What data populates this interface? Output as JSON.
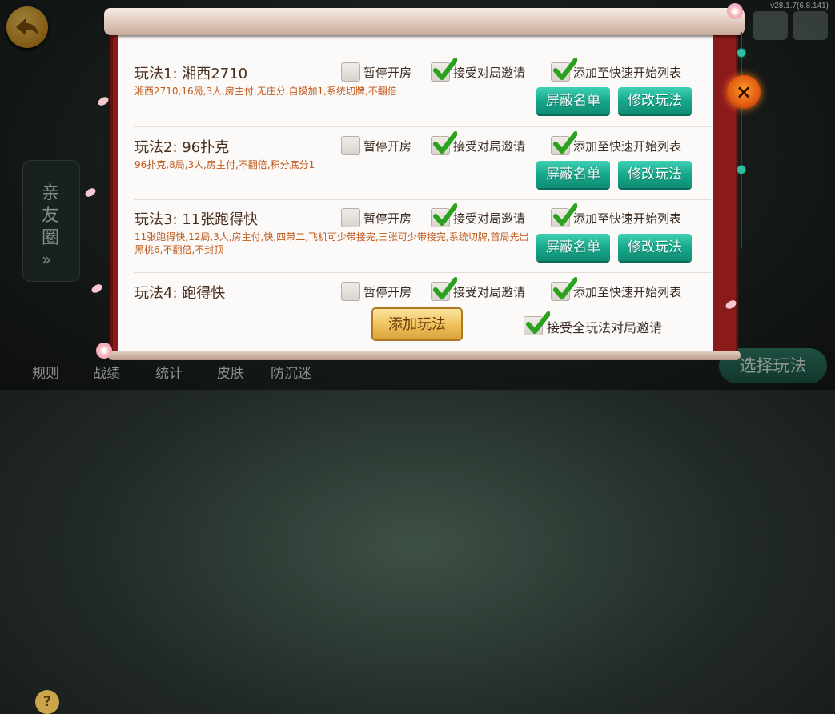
{
  "version": "v28.1.7(6.8.141)",
  "side_tab": {
    "label": "亲友圈",
    "arrow": "»"
  },
  "bottom_bar": {
    "items": [
      "规则",
      "战绩",
      "统计",
      "皮肤",
      "防沉迷"
    ],
    "help": "?"
  },
  "choose_button": "选择玩法",
  "close_icon": "×",
  "modes": [
    {
      "title": "玩法1:  湘西2710",
      "desc": "湘西2710,16局,3人,房主付,无庄分,自摸加1,系统切牌,不翻倍",
      "pause": {
        "label": "暂停开房",
        "checked": false
      },
      "accept": {
        "label": "接受对局邀请",
        "checked": true
      },
      "quick": {
        "label": "添加至快速开始列表",
        "checked": true
      },
      "block_button": "屏蔽名单",
      "edit_button": "修改玩法"
    },
    {
      "title": "玩法2:  96扑克",
      "desc": "96扑克,8局,3人,房主付,不翻倍,积分底分1",
      "pause": {
        "label": "暂停开房",
        "checked": false
      },
      "accept": {
        "label": "接受对局邀请",
        "checked": true
      },
      "quick": {
        "label": "添加至快速开始列表",
        "checked": true
      },
      "block_button": "屏蔽名单",
      "edit_button": "修改玩法"
    },
    {
      "title": "玩法3:  11张跑得快",
      "desc": "11张跑得快,12局,3人,房主付,快,四带二,飞机可少带接完,三张可少带接完,系统切牌,首局先出黑桃6,不翻倍,不封顶",
      "pause": {
        "label": "暂停开房",
        "checked": false
      },
      "accept": {
        "label": "接受对局邀请",
        "checked": true
      },
      "quick": {
        "label": "添加至快速开始列表",
        "checked": true
      },
      "block_button": "屏蔽名单",
      "edit_button": "修改玩法"
    },
    {
      "title": "玩法4:  跑得快",
      "pause": {
        "label": "暂停开房",
        "checked": false
      },
      "accept": {
        "label": "接受对局邀请",
        "checked": true
      },
      "quick": {
        "label": "添加至快速开始列表",
        "checked": true
      }
    }
  ],
  "add_mode_button": "添加玩法",
  "accept_all": {
    "label": "接受全玩法对局邀请",
    "checked": true
  },
  "colors": {
    "accent_green": "#17a88b",
    "frame_red": "#8b1a1a",
    "desc_orange": "#c0591c",
    "gold": "#f0c460"
  }
}
